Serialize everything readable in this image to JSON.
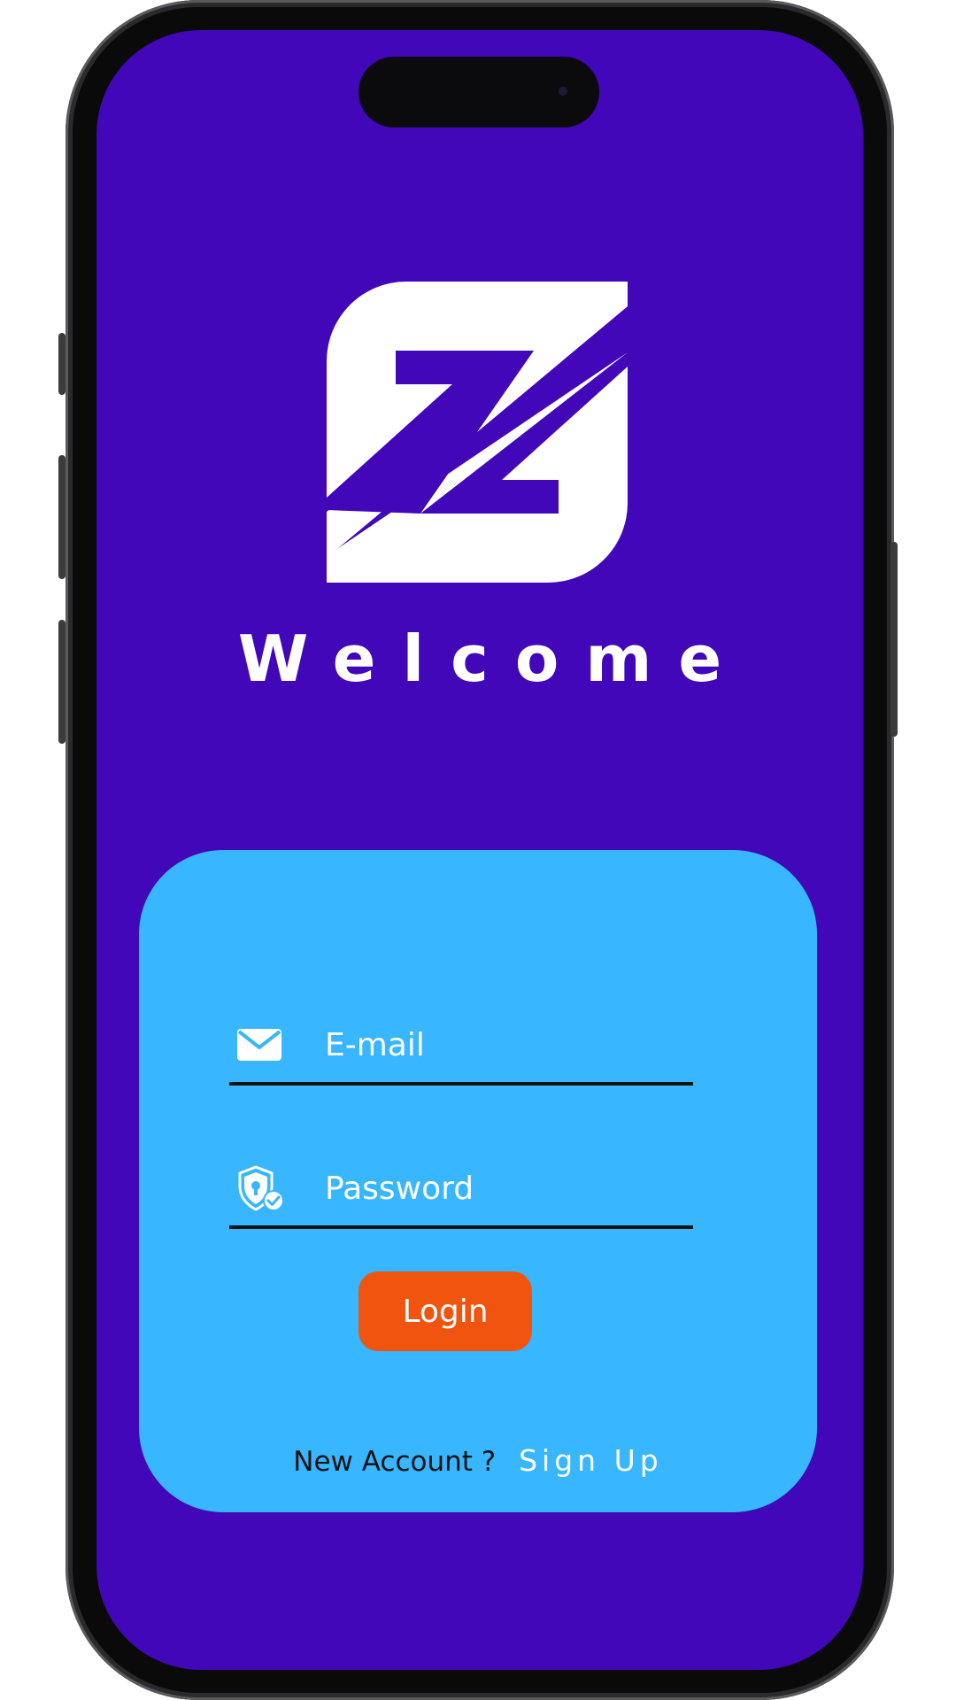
{
  "app": {
    "welcome_title": "Welcome",
    "logo_icon": "z-logo-icon"
  },
  "login_form": {
    "email": {
      "icon": "envelope-icon",
      "placeholder": "E-mail",
      "value": ""
    },
    "password": {
      "icon": "shield-lock-icon",
      "placeholder": "Password",
      "value": ""
    },
    "login_label": "Login",
    "new_account_text": "New Account ?",
    "signup_label": "Sign Up"
  },
  "colors": {
    "background": "#4107b8",
    "card": "#38b6ff",
    "login_button": "#f0540f",
    "text_light": "#ffffff",
    "text_dark": "#111111"
  }
}
